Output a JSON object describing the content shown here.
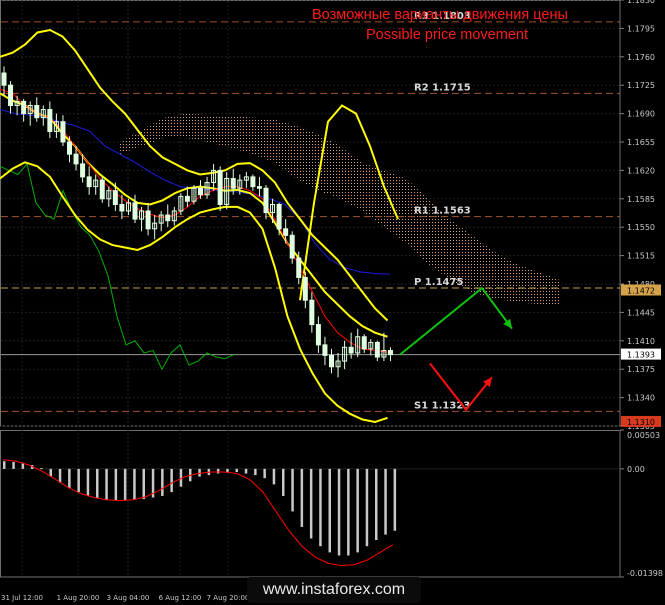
{
  "titles": {
    "ru": "Возможные варианты движения цены",
    "en": "Possible price movement"
  },
  "watermark": "www.instaforex.com",
  "colors": {
    "background": "#000000",
    "grid": "#1f1f1f",
    "axis_text": "#c8c8c8",
    "level_line": "#a0522d",
    "pivot_line": "#c8a04a",
    "bollinger": "#ffff00",
    "ma_red": "#ff0000",
    "ma_blue": "#1c1cdc",
    "chikou": "#00b000",
    "ichimoku_cloud": "#d2a07a",
    "candle": "#e0ffe0",
    "arrow_up": "#10c010",
    "arrow_down": "#ff1010",
    "title": "#ff1c1c"
  },
  "chart_data": [
    {
      "type": "candlestick",
      "symbol": "EURUSD",
      "ylim": [
        1.1305,
        1.183
      ],
      "y_ticks": [
        "1.1830",
        "1.1795",
        "1.1760",
        "1.1725",
        "1.1690",
        "1.1655",
        "1.1620",
        "1.1585",
        "1.1550",
        "1.1515",
        "1.1480",
        "1.1445",
        "1.1410",
        "1.1375",
        "1.1340",
        "1.1305"
      ],
      "x_tick_labels": [
        "31 Jul 12:00",
        "1 Aug 20:00",
        "3 Aug 04:00",
        "6 Aug 12:00",
        "7 Aug 20:00"
      ],
      "current_price_label": "1.1393",
      "price_tags": [
        "1.1472",
        "1.1310"
      ],
      "levels": [
        {
          "name": "R3",
          "label": "R3 1.1803",
          "value": 1.1803
        },
        {
          "name": "R2",
          "label": "R2 1.1715",
          "value": 1.1715
        },
        {
          "name": "R1",
          "label": "R1 1.1563",
          "value": 1.1563
        },
        {
          "name": "P",
          "label": "P 1.1475",
          "value": 1.1475
        },
        {
          "name": "S1",
          "label": "S1 1.1323",
          "value": 1.1323
        }
      ],
      "candles": [
        [
          1.174,
          1.1748,
          1.1712,
          1.1725
        ],
        [
          1.1725,
          1.173,
          1.169,
          1.17
        ],
        [
          1.17,
          1.1712,
          1.1688,
          1.1705
        ],
        [
          1.1705,
          1.1708,
          1.168,
          1.169
        ],
        [
          1.169,
          1.1705,
          1.1675,
          1.17
        ],
        [
          1.17,
          1.171,
          1.168,
          1.1685
        ],
        [
          1.1685,
          1.17,
          1.1675,
          1.1695
        ],
        [
          1.1695,
          1.1705,
          1.166,
          1.1668
        ],
        [
          1.1668,
          1.169,
          1.166,
          1.168
        ],
        [
          1.168,
          1.1688,
          1.165,
          1.1655
        ],
        [
          1.1655,
          1.1662,
          1.163,
          1.164
        ],
        [
          1.164,
          1.165,
          1.162,
          1.1628
        ],
        [
          1.1628,
          1.164,
          1.1605,
          1.1612
        ],
        [
          1.1612,
          1.1625,
          1.159,
          1.16
        ],
        [
          1.16,
          1.1615,
          1.159,
          1.1608
        ],
        [
          1.1608,
          1.1612,
          1.158,
          1.1585
        ],
        [
          1.1585,
          1.16,
          1.1575,
          1.1595
        ],
        [
          1.1595,
          1.1605,
          1.157,
          1.1578
        ],
        [
          1.1578,
          1.159,
          1.156,
          1.157
        ],
        [
          1.157,
          1.1585,
          1.1565,
          1.158
        ],
        [
          1.158,
          1.159,
          1.1555,
          1.156
        ],
        [
          1.156,
          1.1575,
          1.1545,
          1.157
        ],
        [
          1.157,
          1.158,
          1.154,
          1.1548
        ],
        [
          1.1548,
          1.1565,
          1.1535,
          1.1555
        ],
        [
          1.1555,
          1.157,
          1.1545,
          1.1565
        ],
        [
          1.1565,
          1.1578,
          1.155,
          1.1558
        ],
        [
          1.1558,
          1.1575,
          1.1552,
          1.157
        ],
        [
          1.157,
          1.1592,
          1.1565,
          1.1588
        ],
        [
          1.1588,
          1.16,
          1.1575,
          1.1582
        ],
        [
          1.1582,
          1.1602,
          1.1578,
          1.1598
        ],
        [
          1.1598,
          1.1608,
          1.1585,
          1.159
        ],
        [
          1.159,
          1.1612,
          1.1585,
          1.1605
        ],
        [
          1.1605,
          1.1628,
          1.1595,
          1.162
        ],
        [
          1.162,
          1.1625,
          1.157,
          1.1578
        ],
        [
          1.1578,
          1.1618,
          1.1572,
          1.161
        ],
        [
          1.161,
          1.1622,
          1.159,
          1.1598
        ],
        [
          1.1598,
          1.1615,
          1.159,
          1.1608
        ],
        [
          1.1608,
          1.1618,
          1.1598,
          1.1612
        ],
        [
          1.1612,
          1.1615,
          1.1595,
          1.16
        ],
        [
          1.16,
          1.1612,
          1.1588,
          1.1598
        ],
        [
          1.1598,
          1.1602,
          1.156,
          1.1568
        ],
        [
          1.1568,
          1.1585,
          1.1555,
          1.1578
        ],
        [
          1.1578,
          1.158,
          1.154,
          1.1548
        ],
        [
          1.1548,
          1.156,
          1.153,
          1.154
        ],
        [
          1.154,
          1.1545,
          1.1505,
          1.1512
        ],
        [
          1.1512,
          1.152,
          1.148,
          1.1488
        ],
        [
          1.1488,
          1.1495,
          1.145,
          1.146
        ],
        [
          1.146,
          1.147,
          1.142,
          1.143
        ],
        [
          1.143,
          1.144,
          1.1395,
          1.1405
        ],
        [
          1.1405,
          1.1415,
          1.138,
          1.1392
        ],
        [
          1.1392,
          1.14,
          1.137,
          1.1378
        ],
        [
          1.1378,
          1.1395,
          1.1365,
          1.1385
        ],
        [
          1.1385,
          1.141,
          1.1375,
          1.1402
        ],
        [
          1.1402,
          1.142,
          1.1388,
          1.1395
        ],
        [
          1.1395,
          1.1425,
          1.139,
          1.1415
        ],
        [
          1.1415,
          1.1418,
          1.1395,
          1.14
        ],
        [
          1.14,
          1.1412,
          1.1392,
          1.1408
        ],
        [
          1.1408,
          1.141,
          1.1385,
          1.139
        ],
        [
          1.139,
          1.142,
          1.1385,
          1.1398
        ],
        [
          1.1398,
          1.1402,
          1.1385,
          1.1393
        ]
      ],
      "indicators": {
        "bollinger_upper": [
          1.176,
          1.1765,
          1.1775,
          1.179,
          1.1793,
          1.1785,
          1.1768,
          1.1745,
          1.1722,
          1.1705,
          1.169,
          1.167,
          1.165,
          1.1636,
          1.1628,
          1.162,
          1.1615,
          1.1617,
          1.162,
          1.1628,
          1.1629,
          1.162,
          1.1605,
          1.158,
          1.156,
          1.154,
          1.1525,
          1.151,
          1.149,
          1.147,
          1.145,
          1.1435
        ],
        "bollinger_middle": [
          1.1715,
          1.1706,
          1.17,
          1.169,
          1.1685,
          1.1665,
          1.165,
          1.163,
          1.1615,
          1.1603,
          1.159,
          1.158,
          1.1578,
          1.1583,
          1.1592,
          1.1598,
          1.16,
          1.1598,
          1.1595,
          1.1596,
          1.1592,
          1.158,
          1.1555,
          1.153,
          1.151,
          1.149,
          1.147,
          1.1455,
          1.144,
          1.1428,
          1.142,
          1.1415
        ],
        "bollinger_lower": [
          1.161,
          1.1622,
          1.163,
          1.1625,
          1.1612,
          1.1588,
          1.1565,
          1.1547,
          1.1535,
          1.1528,
          1.1525,
          1.1522,
          1.1528,
          1.1538,
          1.155,
          1.156,
          1.1568,
          1.1572,
          1.1575,
          1.1575,
          1.1568,
          1.1548,
          1.15,
          1.144,
          1.14,
          1.137,
          1.1345,
          1.133,
          1.132,
          1.1313,
          1.131,
          1.1315
        ],
        "bollinger_upper_projection": [
          1.146,
          1.158,
          1.168,
          1.17,
          1.169,
          1.165,
          1.16,
          1.156
        ],
        "ma_red": [
          1.172,
          1.1715,
          1.17,
          1.169,
          1.1685,
          1.167,
          1.165,
          1.163,
          1.161,
          1.1595,
          1.1583,
          1.1573,
          1.1566,
          1.1562,
          1.1565,
          1.1575,
          1.1588,
          1.1595,
          1.16,
          1.16,
          1.1595,
          1.1585,
          1.156,
          1.153,
          1.15,
          1.147,
          1.144,
          1.142,
          1.1408,
          1.14,
          1.1398,
          1.1396
        ],
        "ma_blue": [
          1.1695,
          1.169,
          1.1688,
          1.1685,
          1.168,
          1.1675,
          1.1668,
          1.165,
          1.164,
          1.163,
          1.1618,
          1.1608,
          1.16,
          1.1598,
          1.1596,
          1.1595,
          1.1593,
          1.159,
          1.1585,
          1.1578,
          1.156,
          1.153,
          1.151,
          1.15,
          1.1495,
          1.1493,
          1.1492
        ],
        "chikou_span": [
          1.1625,
          1.162,
          1.1615,
          1.1628,
          1.158,
          1.1565,
          1.156,
          1.1595,
          1.157,
          1.155,
          1.154,
          1.152,
          1.149,
          1.144,
          1.1405,
          1.141,
          1.1395,
          1.1398,
          1.1375,
          1.1395,
          1.1405,
          1.138,
          1.1385,
          1.1395,
          1.139,
          1.1388,
          1.1393
        ],
        "cloud_upper": [
          1.1655,
          1.167,
          1.1685,
          1.169,
          1.1688,
          1.1688,
          1.1685,
          1.1683,
          1.1675,
          1.1665,
          1.165,
          1.163,
          1.162,
          1.161,
          1.1585,
          1.156,
          1.154,
          1.152,
          1.1505,
          1.1495,
          1.1485
        ],
        "cloud_lower": [
          1.164,
          1.165,
          1.166,
          1.166,
          1.1655,
          1.1648,
          1.164,
          1.163,
          1.161,
          1.1595,
          1.1585,
          1.157,
          1.155,
          1.153,
          1.1505,
          1.1485,
          1.147,
          1.1462,
          1.1458,
          1.1455,
          1.1453
        ]
      },
      "scenarios": [
        {
          "direction": "up",
          "path": [
            1.1393,
            1.1475,
            1.1425
          ],
          "color": "#10c010"
        },
        {
          "direction": "down",
          "path": [
            1.1382,
            1.1325,
            1.1365
          ],
          "color": "#ff1010"
        }
      ]
    },
    {
      "type": "bar",
      "indicator": "MACD histogram with signal line",
      "ylim": [
        -0.01398,
        0.00503
      ],
      "y_ticks": [
        "0.00503",
        "0.00",
        "-0.01398"
      ],
      "histogram": [
        0.001,
        0.0009,
        0.0008,
        0.0005,
        0.0001,
        -0.001,
        -0.0018,
        -0.0025,
        -0.003,
        -0.0035,
        -0.0038,
        -0.004,
        -0.0041,
        -0.0041,
        -0.004,
        -0.0039,
        -0.0037,
        -0.0035,
        -0.003,
        -0.0023,
        -0.0016,
        -0.001,
        -0.0008,
        -0.0006,
        -0.0005,
        -0.0004,
        -0.0006,
        -0.0008,
        -0.0012,
        -0.002,
        -0.0035,
        -0.0055,
        -0.0075,
        -0.009,
        -0.01,
        -0.0108,
        -0.0112,
        -0.0112,
        -0.0108,
        -0.01,
        -0.0092,
        -0.0085,
        -0.008
      ],
      "signal": [
        0.0012,
        0.001,
        0.0005,
        -0.0003,
        -0.0013,
        -0.0024,
        -0.0032,
        -0.0037,
        -0.004,
        -0.0041,
        -0.004,
        -0.0036,
        -0.0028,
        -0.0018,
        -0.001,
        -0.0006,
        -0.0004,
        -0.0004,
        -0.0006,
        -0.0014,
        -0.003,
        -0.0055,
        -0.008,
        -0.01,
        -0.0114,
        -0.0122,
        -0.0125,
        -0.0124,
        -0.0118,
        -0.0108,
        -0.0098
      ]
    }
  ]
}
